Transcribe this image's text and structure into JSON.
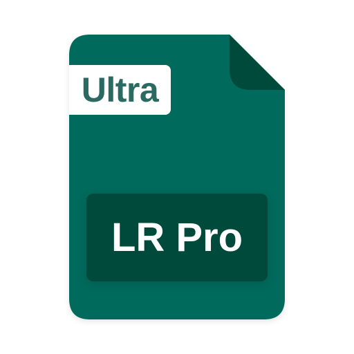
{
  "icon": {
    "name": "file-icon",
    "colors": {
      "body": "#006b5c",
      "fold": "#004a3c",
      "label_box": "#004a3c",
      "tag_background": "#ffffff",
      "tag_text": "#2a6a60",
      "label_text": "#ffffff"
    }
  },
  "tag": {
    "text": "Ultra"
  },
  "label": {
    "text": "LR Pro"
  }
}
